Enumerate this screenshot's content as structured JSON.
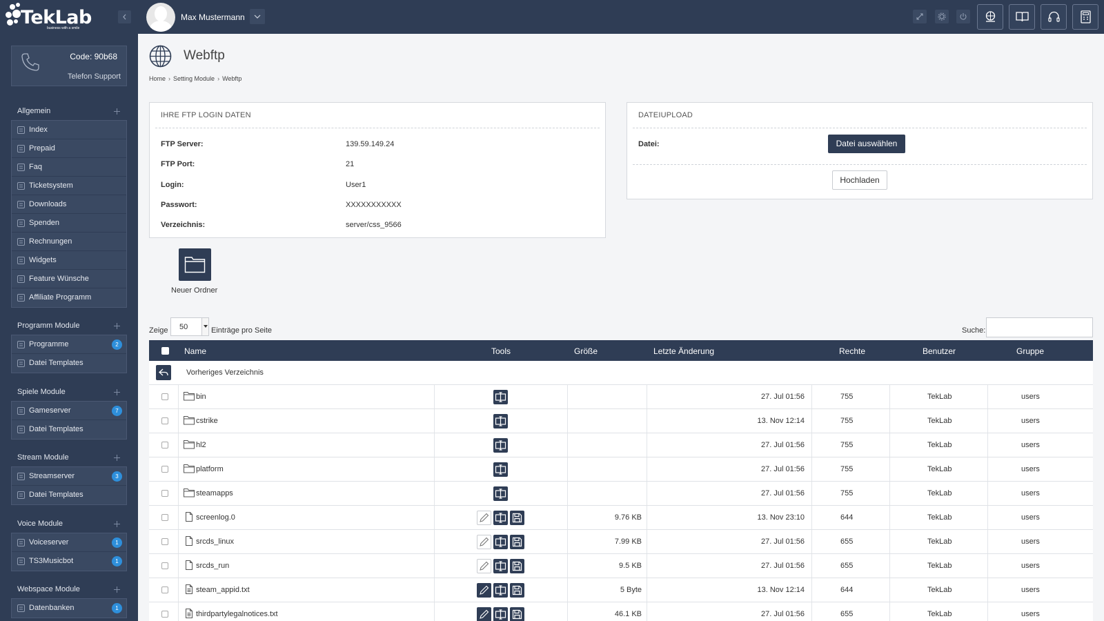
{
  "brand": {
    "name": "TekLab",
    "tagline": "business with a smile"
  },
  "topbar": {
    "user_name": "Max Mustermann"
  },
  "support": {
    "code": "Code: 90b68",
    "label": "Telefon Support"
  },
  "sidebar": {
    "sections": [
      {
        "title": "Allgemein",
        "items": [
          {
            "label": "Index",
            "icon": "home-icon"
          },
          {
            "label": "Prepaid",
            "icon": "newspaper-icon"
          },
          {
            "label": "Faq",
            "icon": "book-icon"
          },
          {
            "label": "Ticketsystem",
            "icon": "gear-icon"
          },
          {
            "label": "Downloads",
            "icon": "cloud-download-icon"
          },
          {
            "label": "Spenden",
            "icon": "donation-icon"
          },
          {
            "label": "Rechnungen",
            "icon": "invoice-icon"
          },
          {
            "label": "Widgets",
            "icon": "widget-icon"
          },
          {
            "label": "Feature Wünsche",
            "icon": "lightbulb-icon"
          },
          {
            "label": "Affiliate Programm",
            "icon": "handshake-icon"
          }
        ]
      },
      {
        "title": "Programm Module",
        "items": [
          {
            "label": "Programme",
            "icon": "window-icon",
            "badge": "2"
          },
          {
            "label": "Datei Templates",
            "icon": "document-icon"
          }
        ]
      },
      {
        "title": "Spiele Module",
        "items": [
          {
            "label": "Gameserver",
            "icon": "gamepad-icon",
            "badge": "7"
          },
          {
            "label": "Datei Templates",
            "icon": "document-icon"
          }
        ]
      },
      {
        "title": "Stream Module",
        "items": [
          {
            "label": "Streamserver",
            "icon": "monitor-icon",
            "badge": "3"
          },
          {
            "label": "Datei Templates",
            "icon": "document-icon"
          }
        ]
      },
      {
        "title": "Voice Module",
        "items": [
          {
            "label": "Voiceserver",
            "icon": "headset-icon",
            "badge": "1"
          },
          {
            "label": "TS3Musicbot",
            "icon": "speaker-icon",
            "badge": "1"
          }
        ]
      },
      {
        "title": "Webspace Module",
        "items": [
          {
            "label": "Datenbanken",
            "icon": "database-icon",
            "badge": "1"
          }
        ]
      }
    ]
  },
  "page": {
    "title": "Webftp",
    "breadcrumb": [
      "Home",
      "Setting Module",
      "Webftp"
    ]
  },
  "ftp_login": {
    "title": "IHRE FTP LOGIN DATEN",
    "rows": [
      {
        "key": "FTP Server:",
        "value": "139.59.149.24"
      },
      {
        "key": "FTP Port:",
        "value": "21"
      },
      {
        "key": "Login:",
        "value": "User1"
      },
      {
        "key": "Passwort:",
        "value": "XXXXXXXXXXX"
      },
      {
        "key": "Verzeichnis:",
        "value": "server/css_9566"
      }
    ]
  },
  "upload": {
    "title": "DATEIUPLOAD",
    "file_label": "Datei:",
    "choose_label": "Datei auswählen",
    "upload_label": "Hochladen"
  },
  "new_folder_label": "Neuer Ordner",
  "table_controls": {
    "show_label": "Zeige",
    "page_size": "50",
    "per_page_label": "Einträge pro Seite",
    "search_label": "Suche:",
    "search_value": ""
  },
  "table": {
    "columns": [
      "Name",
      "Tools",
      "Größe",
      "Letzte Änderung",
      "Rechte",
      "Benutzer",
      "Gruppe"
    ],
    "parent_label": "Vorheriges Verzeichnis",
    "rows": [
      {
        "name": "bin",
        "type": "folder",
        "size": "",
        "modified": "27. Jul 01:56",
        "perms": "755",
        "user": "TekLab",
        "group": "users"
      },
      {
        "name": "cstrike",
        "type": "folder",
        "size": "",
        "modified": "13. Nov 12:14",
        "perms": "755",
        "user": "TekLab",
        "group": "users"
      },
      {
        "name": "hl2",
        "type": "folder",
        "size": "",
        "modified": "27. Jul 01:56",
        "perms": "755",
        "user": "TekLab",
        "group": "users"
      },
      {
        "name": "platform",
        "type": "folder",
        "size": "",
        "modified": "27. Jul 01:56",
        "perms": "755",
        "user": "TekLab",
        "group": "users"
      },
      {
        "name": "steamapps",
        "type": "folder",
        "size": "",
        "modified": "27. Jul 01:56",
        "perms": "755",
        "user": "TekLab",
        "group": "users"
      },
      {
        "name": "screenlog.0",
        "type": "file",
        "size": "9.76 KB",
        "modified": "13. Nov 23:10",
        "perms": "644",
        "user": "TekLab",
        "group": "users"
      },
      {
        "name": "srcds_linux",
        "type": "file",
        "size": "7.99 KB",
        "modified": "27. Jul 01:56",
        "perms": "655",
        "user": "TekLab",
        "group": "users"
      },
      {
        "name": "srcds_run",
        "type": "file",
        "size": "9.5 KB",
        "modified": "27. Jul 01:56",
        "perms": "655",
        "user": "TekLab",
        "group": "users"
      },
      {
        "name": "steam_appid.txt",
        "type": "textfile",
        "size": "5 Byte",
        "modified": "13. Nov 12:14",
        "perms": "644",
        "user": "TekLab",
        "group": "users"
      },
      {
        "name": "thirdpartylegalnotices.txt",
        "type": "textfile",
        "size": "46.1 KB",
        "modified": "27. Jul 01:56",
        "perms": "655",
        "user": "TekLab",
        "group": "users"
      }
    ]
  },
  "colors": {
    "navy": "#2f3d55",
    "badge": "#2e8fdb",
    "background": "#f4f5f7"
  }
}
